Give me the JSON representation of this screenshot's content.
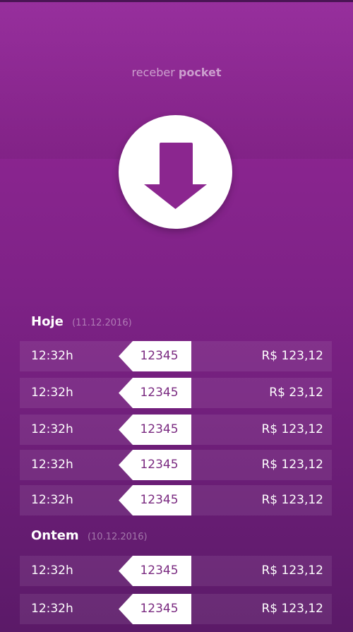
{
  "header": {
    "title_light": "receber",
    "title_bold": "pocket"
  },
  "receive_button": {
    "icon": "download-arrow-icon"
  },
  "sections": [
    {
      "title": "Hoje",
      "date": "(11.12.2016)",
      "rows": [
        {
          "time": "12:32h",
          "code": "12345",
          "amount": "R$ 123,12"
        },
        {
          "time": "12:32h",
          "code": "12345",
          "amount": "R$ 23,12"
        },
        {
          "time": "12:32h",
          "code": "12345",
          "amount": "R$ 123,12"
        },
        {
          "time": "12:32h",
          "code": "12345",
          "amount": "R$ 123,12"
        },
        {
          "time": "12:32h",
          "code": "12345",
          "amount": "R$ 123,12"
        }
      ]
    },
    {
      "title": "Ontem",
      "date": "(10.12.2016)",
      "rows": [
        {
          "time": "12:32h",
          "code": "12345",
          "amount": "R$ 123,12"
        },
        {
          "time": "12:32h",
          "code": "12345",
          "amount": "R$ 123,12"
        }
      ]
    }
  ]
}
